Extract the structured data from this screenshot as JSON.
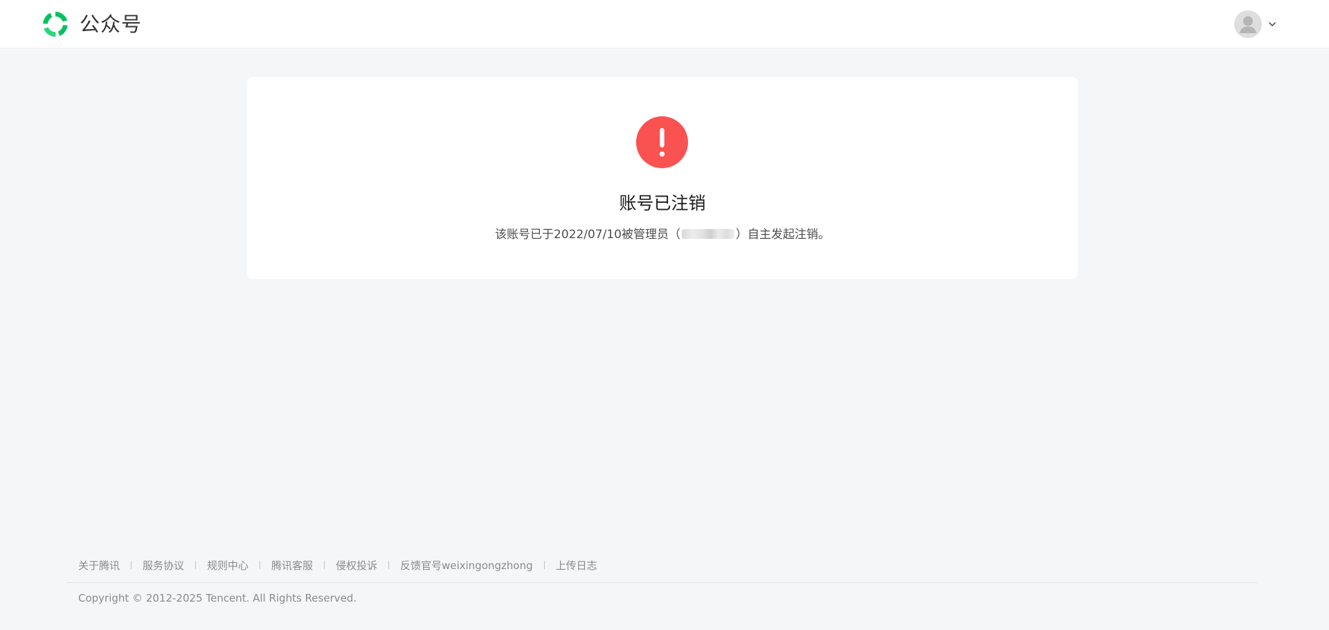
{
  "header": {
    "brand_name": "公众号",
    "logo_icon": "weixin-official-account-logo-icon",
    "avatar_icon": "user-avatar-icon",
    "menu_icon": "chevron-down-icon",
    "colors": {
      "brand_green": "#07c160",
      "logo_green_light": "#2bd67b"
    }
  },
  "notice": {
    "icon": "exclamation-icon",
    "icon_color": "#fa5151",
    "title": "账号已注销",
    "desc_before": "该账号已于2022/07/10被管理员（",
    "desc_after": "）自主发起注销。"
  },
  "footer": {
    "links": [
      {
        "label": "关于腾讯"
      },
      {
        "label": "服务协议"
      },
      {
        "label": "规则中心"
      },
      {
        "label": "腾讯客服"
      },
      {
        "label": "侵权投诉"
      },
      {
        "label": "反馈官号weixingongzhong"
      },
      {
        "label": "上传日志"
      }
    ],
    "copyright": "Copyright © 2012-2025 Tencent. All Rights Reserved."
  }
}
